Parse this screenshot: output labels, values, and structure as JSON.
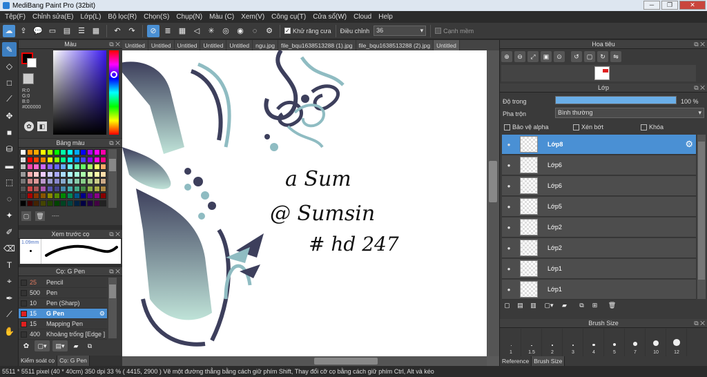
{
  "window": {
    "title": "MediBang Paint Pro (32bit)"
  },
  "menu": [
    "Tệp(F)",
    "Chỉnh sửa(E)",
    "Lớp(L)",
    "Bộ lọc(R)",
    "Chọn(S)",
    "Chụp(N)",
    "Màu (C)",
    "Xem(V)",
    "Công cụ(T)",
    "Cửa sổ(W)",
    "Cloud",
    "Help"
  ],
  "toolbar": {
    "antialias_label": "Khử răng cưa",
    "adjust_label": "Điều chỉnh",
    "adjust_value": "36",
    "edge_label": "Cạnh mềm"
  },
  "color_panel": {
    "title": "Màu",
    "r": "R:0",
    "g": "G:0",
    "b": "B:0",
    "hex": "#000000"
  },
  "palette_panel": {
    "title": "Bảng màu",
    "footer": "----"
  },
  "preview_panel": {
    "title": "Xem trước cọ",
    "size": "1.09mm"
  },
  "brush_panel": {
    "title": "Cọ: G Pen",
    "items": [
      {
        "size": "25",
        "name": "Pencil",
        "color": "#333333",
        "size_color": "#e07a5f"
      },
      {
        "size": "500",
        "name": "Pen",
        "color": "#333333",
        "size_color": "#dddddd"
      },
      {
        "size": "10",
        "name": "Pen (Sharp)",
        "color": "#333333",
        "size_color": "#dddddd"
      },
      {
        "size": "15",
        "name": "G Pen",
        "color": "#e02020",
        "size_color": "#ffffff"
      },
      {
        "size": "15",
        "name": "Mapping Pen",
        "color": "#e02020",
        "size_color": "#dddddd"
      },
      {
        "size": "400",
        "name": "Khoảng trống [Edge ]",
        "color": "#333333",
        "size_color": "#dddddd"
      }
    ]
  },
  "dock_tabs": [
    "Kiểm soát cọ",
    "Cọ: G Pen"
  ],
  "canvas_tabs": [
    "Untitled",
    "Untitled",
    "Untitled",
    "Untitled",
    "Untitled",
    "ngu.jpg",
    "file_bqu1638513288 (1).jpg",
    "file_bqu1638513288 (2).jpg",
    "Untitled"
  ],
  "canvas_text": {
    "line1": "a Sum",
    "line2": "@ Sumsin",
    "line3": "# hd 247"
  },
  "navigator": {
    "title": "Hoa tiêu"
  },
  "layers_panel": {
    "title": "Lớp",
    "opacity_label": "Độ trong",
    "opacity_value": "100 %",
    "opacity_fraction": 1.0,
    "blend_label": "Pha trộn",
    "blend_value": "Bình thường",
    "protect_alpha": "Bảo vệ alpha",
    "clipping": "Xén bớt",
    "lock": "Khóa",
    "layers": [
      "Lớp8",
      "Lớp6",
      "Lớp6",
      "Lớp5",
      "Lớp2",
      "Lớp2",
      "Lớp1",
      "Lớp1"
    ]
  },
  "brush_size_panel": {
    "title": "Brush Size",
    "sizes": [
      "1",
      "1.5",
      "2",
      "3",
      "4",
      "5",
      "7",
      "10",
      "12"
    ]
  },
  "right_tabs": [
    "Reference",
    "Brush Size"
  ],
  "status": "5511 * 5511 pixel  (40 * 40cm)  350 dpi  33 %  ( 4415, 2900 )  Vẽ một đường thẳng bằng cách giữ phím Shift, Thay đổi cỡ cọ bằng cách giữ phím Ctrl, Alt và kéo",
  "colors": {
    "accent": "#4a90d4",
    "panel": "#3a3a3a"
  }
}
